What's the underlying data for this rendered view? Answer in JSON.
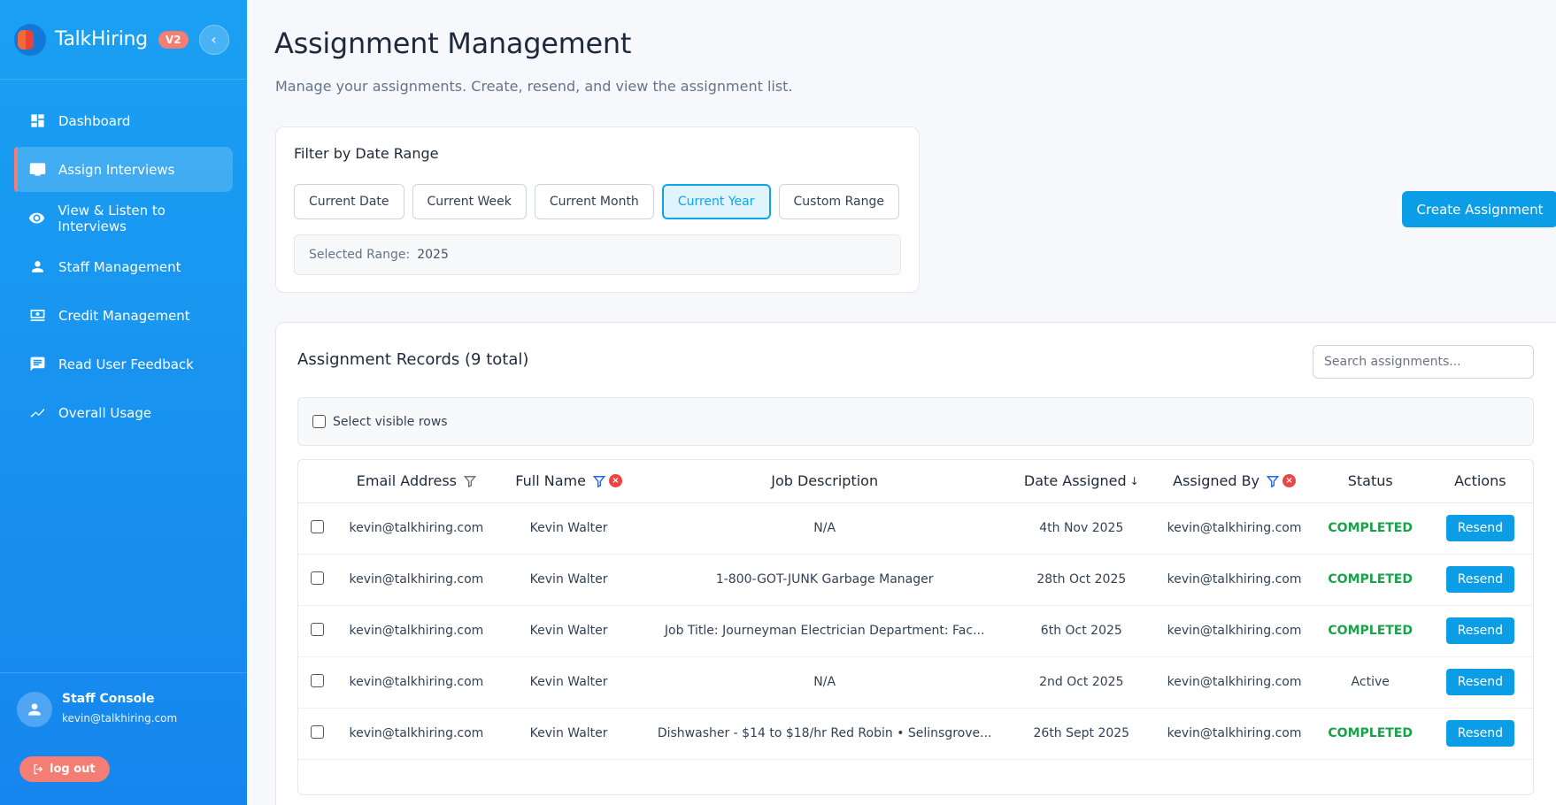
{
  "brand": {
    "name": "TalkHiring",
    "version_badge": "V2",
    "collapse_icon": "chevron-left-icon"
  },
  "sidebar": {
    "items": [
      {
        "label": "Dashboard",
        "icon": "dashboard-icon",
        "active": false
      },
      {
        "label": "Assign Interviews",
        "icon": "assign-icon",
        "active": true
      },
      {
        "label": "View & Listen to Interviews",
        "icon": "eye-icon",
        "active": false
      },
      {
        "label": "Staff Management",
        "icon": "person-icon",
        "active": false
      },
      {
        "label": "Credit Management",
        "icon": "credit-icon",
        "active": false
      },
      {
        "label": "Read User Feedback",
        "icon": "feedback-icon",
        "active": false
      },
      {
        "label": "Overall Usage",
        "icon": "trend-icon",
        "active": false
      }
    ],
    "user": {
      "name": "Staff Console",
      "email": "kevin@talkhiring.com"
    },
    "logout_label": "log out"
  },
  "page": {
    "title": "Assignment Management",
    "subtitle": "Manage your assignments. Create, resend, and view the assignment list."
  },
  "filter": {
    "title": "Filter by Date Range",
    "buttons": [
      "Current Date",
      "Current Week",
      "Current Month",
      "Current Year",
      "Custom Range"
    ],
    "selected_index": 3,
    "selected_range_label": "Selected Range:",
    "selected_range_value": "2025"
  },
  "create_button": "Create Assignment",
  "records": {
    "title": "Assignment Records (9 total)",
    "search_placeholder": "Search assignments...",
    "select_visible_label": "Select visible rows",
    "columns": [
      "Email Address",
      "Full Name",
      "Job Description",
      "Date Assigned",
      "Assigned By",
      "Status",
      "Actions"
    ],
    "sort_indicator": "↓",
    "clear_filter_glyph": "×",
    "rows": [
      {
        "email": "kevin@talkhiring.com",
        "name": "Kevin Walter",
        "job": "N/A",
        "date": "4th Nov 2025",
        "assigned_by": "kevin@talkhiring.com",
        "status": "COMPLETED",
        "action": "Resend"
      },
      {
        "email": "kevin@talkhiring.com",
        "name": "Kevin Walter",
        "job": "1-800-GOT-JUNK Garbage Manager",
        "date": "28th Oct 2025",
        "assigned_by": "kevin@talkhiring.com",
        "status": "COMPLETED",
        "action": "Resend"
      },
      {
        "email": "kevin@talkhiring.com",
        "name": "Kevin Walter",
        "job": "Job Title: Journeyman Electrician Department: Fac...",
        "date": "6th Oct 2025",
        "assigned_by": "kevin@talkhiring.com",
        "status": "COMPLETED",
        "action": "Resend"
      },
      {
        "email": "kevin@talkhiring.com",
        "name": "Kevin Walter",
        "job": "N/A",
        "date": "2nd Oct 2025",
        "assigned_by": "kevin@talkhiring.com",
        "status": "Active",
        "action": "Resend"
      },
      {
        "email": "kevin@talkhiring.com",
        "name": "Kevin Walter",
        "job": "Dishwasher - $14 to $18/hr Red Robin • Selinsgrove...",
        "date": "26th Sept 2025",
        "assigned_by": "kevin@talkhiring.com",
        "status": "COMPLETED",
        "action": "Resend"
      }
    ]
  },
  "colors": {
    "primary": "#0b9de6",
    "accent": "#f47e73",
    "completed": "#16a34a",
    "filter_active": "#2563eb",
    "clear": "#ef4444"
  }
}
